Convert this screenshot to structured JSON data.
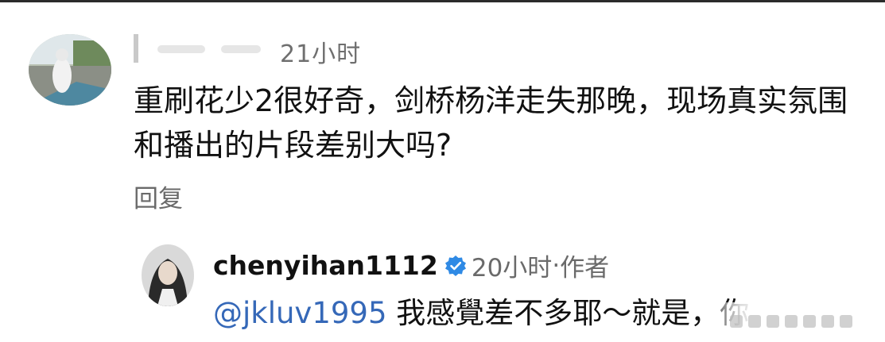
{
  "comment": {
    "author_visible": "",
    "time": "21小时",
    "text": "重刷花少2很好奇，剑桥杨洋走失那晚，现场真实氛围和播出的片段差别大吗?",
    "reply_label": "回复"
  },
  "reply": {
    "username": "chenyihan1112",
    "time": "20小时",
    "separator": "·",
    "role": "作者",
    "mention": "@jkluv1995",
    "text": " 我感覺差不多耶～就是，你"
  },
  "colors": {
    "mention": "#3568b8",
    "verified": "#2f8ae5",
    "meta": "#6a6a6a"
  },
  "icons": {
    "verified": "verified-badge-icon"
  }
}
